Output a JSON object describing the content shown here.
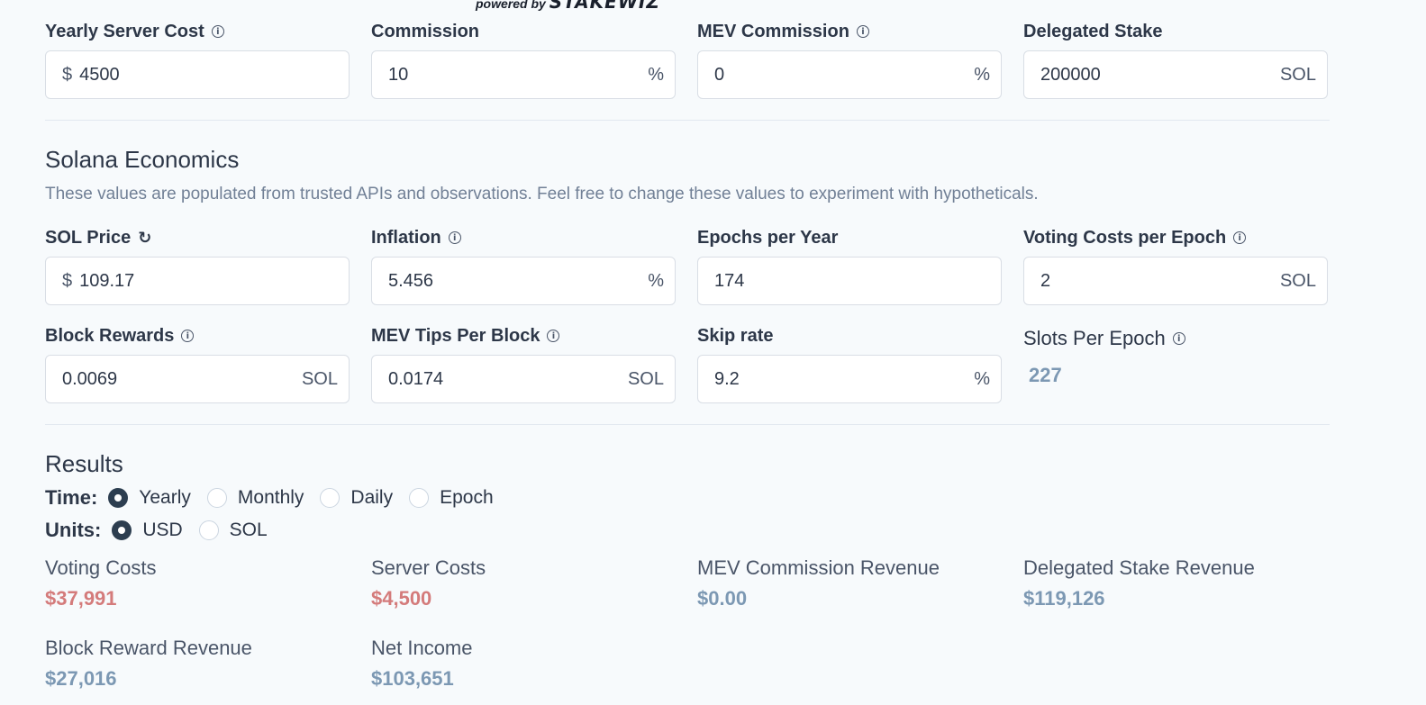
{
  "powered": {
    "text": "powered by",
    "brand": "STAKEWIZ"
  },
  "validator": {
    "fields": [
      {
        "label": "Yearly Server Cost",
        "info": true,
        "prefix": "$",
        "value": "4500",
        "suffix": ""
      },
      {
        "label": "Commission",
        "info": false,
        "prefix": "",
        "value": "10",
        "suffix": "%"
      },
      {
        "label": "MEV Commission",
        "info": true,
        "prefix": "",
        "value": "0",
        "suffix": "%"
      },
      {
        "label": "Delegated Stake",
        "info": false,
        "prefix": "",
        "value": "200000",
        "suffix": "SOL"
      }
    ]
  },
  "economics": {
    "title": "Solana Economics",
    "description": "These values are populated from trusted APIs and observations. Feel free to change these values to experiment with hypotheticals.",
    "row1": [
      {
        "label": "SOL Price",
        "refresh": "↻",
        "prefix": "$",
        "value": "109.17",
        "suffix": ""
      },
      {
        "label": "Inflation",
        "info": true,
        "prefix": "",
        "value": "5.456",
        "suffix": "%"
      },
      {
        "label": "Epochs per Year",
        "info": false,
        "prefix": "",
        "value": "174",
        "suffix": ""
      },
      {
        "label": "Voting Costs per Epoch",
        "info": true,
        "prefix": "",
        "value": "2",
        "suffix": "SOL"
      }
    ],
    "row2": [
      {
        "label": "Block Rewards",
        "info": true,
        "prefix": "",
        "value": "0.0069",
        "suffix": "SOL"
      },
      {
        "label": "MEV Tips Per Block",
        "info": true,
        "prefix": "",
        "value": "0.0174",
        "suffix": "SOL"
      },
      {
        "label": "Skip rate",
        "info": false,
        "prefix": "",
        "value": "9.2",
        "suffix": "%"
      }
    ],
    "slots": {
      "label": "Slots Per Epoch",
      "value": "227"
    }
  },
  "results": {
    "title": "Results",
    "time": {
      "label": "Time:",
      "options": [
        "Yearly",
        "Monthly",
        "Daily",
        "Epoch"
      ],
      "selected": "Yearly"
    },
    "units": {
      "label": "Units:",
      "options": [
        "USD",
        "SOL"
      ],
      "selected": "USD"
    },
    "stats": [
      {
        "label": "Voting Costs",
        "value": "$37,991"
      },
      {
        "label": "Server Costs",
        "value": "$4,500"
      },
      {
        "label": "MEV Commission Revenue",
        "value": "$0.00"
      },
      {
        "label": "Delegated Stake Revenue",
        "value": "$119,126"
      },
      {
        "label": "Block Reward Revenue",
        "value": "$27,016"
      },
      {
        "label": "Net Income",
        "value": "$103,651"
      }
    ]
  },
  "colors": {
    "negative": "#d47b7b",
    "positive": "#7c98b3",
    "radio_selected": "#2d3e50"
  }
}
